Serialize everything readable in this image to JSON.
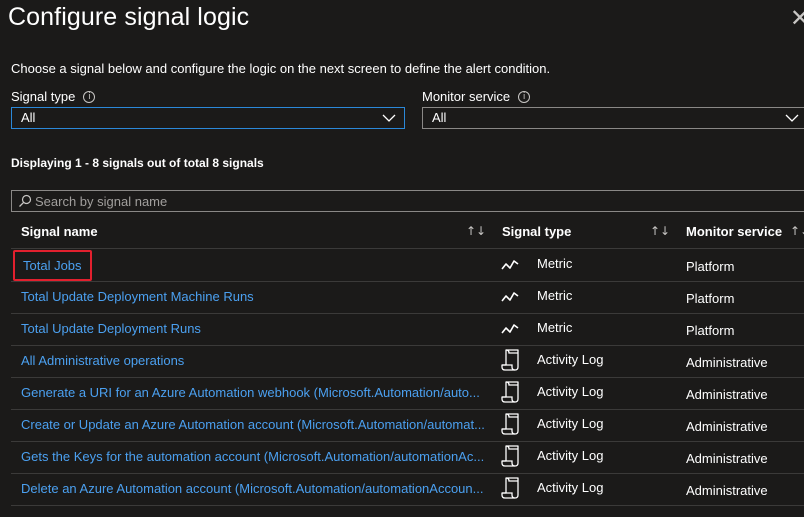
{
  "panel": {
    "title": "Configure signal logic",
    "close_glyph": "✕",
    "intro": "Choose a signal below and configure the logic on the next screen to define the alert condition."
  },
  "filters": {
    "signal_type": {
      "label": "Signal type",
      "value": "All",
      "info_glyph": "i"
    },
    "monitor_service": {
      "label": "Monitor service",
      "value": "All",
      "info_glyph": "i"
    }
  },
  "results": {
    "count_text": "Displaying 1 - 8 signals out of total 8 signals"
  },
  "search": {
    "placeholder": "Search by signal name",
    "value": ""
  },
  "table": {
    "columns": [
      {
        "label": "Signal name",
        "sort_glyph": "↑↓"
      },
      {
        "label": "Signal type",
        "sort_glyph": "↑↓"
      },
      {
        "label": "Monitor service",
        "sort_glyph": "↑↓"
      }
    ],
    "rows": [
      {
        "name": "Total Jobs",
        "type": "Metric",
        "type_icon": "metric-icon",
        "service": "Platform",
        "highlighted": true
      },
      {
        "name": "Total Update Deployment Machine Runs",
        "type": "Metric",
        "type_icon": "metric-icon",
        "service": "Platform"
      },
      {
        "name": "Total Update Deployment Runs",
        "type": "Metric",
        "type_icon": "metric-icon",
        "service": "Platform"
      },
      {
        "name": "All Administrative operations",
        "type": "Activity Log",
        "type_icon": "activity-log-icon",
        "service": "Administrative"
      },
      {
        "name": "Generate a URI for an Azure Automation webhook (Microsoft.Automation/auto...",
        "type": "Activity Log",
        "type_icon": "activity-log-icon",
        "service": "Administrative"
      },
      {
        "name": "Create or Update an Azure Automation account (Microsoft.Automation/automat...",
        "type": "Activity Log",
        "type_icon": "activity-log-icon",
        "service": "Administrative"
      },
      {
        "name": "Gets the Keys for the automation account (Microsoft.Automation/automationAc...",
        "type": "Activity Log",
        "type_icon": "activity-log-icon",
        "service": "Administrative"
      },
      {
        "name": "Delete an Azure Automation account (Microsoft.Automation/automationAccoun...",
        "type": "Activity Log",
        "type_icon": "activity-log-icon",
        "service": "Administrative"
      }
    ]
  },
  "colors": {
    "background": "#1b1a19",
    "link": "#4ba0f0",
    "highlight_border": "#e3202e",
    "focus_border": "#2b88d8",
    "divider": "#3b3a39"
  }
}
